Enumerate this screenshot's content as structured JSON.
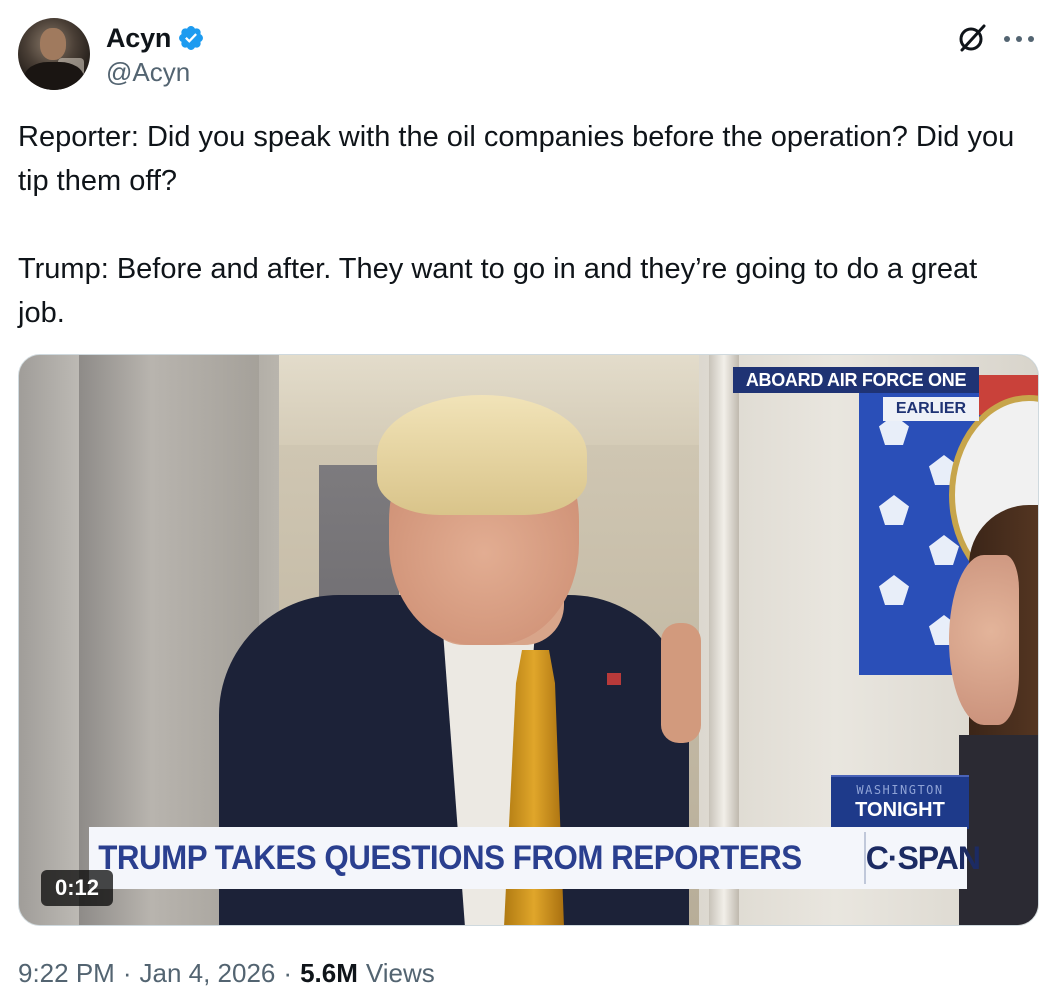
{
  "author": {
    "display_name": "Acyn",
    "handle": "@Acyn",
    "verified": true,
    "verified_color": "#1d9bf0"
  },
  "icons": {
    "grok": "grok-icon",
    "more": "more-options-icon"
  },
  "tweet": {
    "text": "Reporter: Did you speak with the oil companies before the operation? Did you tip them off?\n\nTrump: Before and after. They want to go in and they’re going to do a great job."
  },
  "media": {
    "type": "video",
    "duration": "0:12",
    "chyron": "TRUMP TAKES QUESTIONS FROM REPORTERS",
    "network": "C·SPAN",
    "location_label": "ABOARD AIR FORCE ONE",
    "location_sub": "EARLIER",
    "show_small": "WASHINGTON",
    "show_name": "TONIGHT"
  },
  "meta": {
    "time": "9:22 PM",
    "date": "Jan 4, 2026",
    "views_count": "5.6M",
    "views_label": "Views"
  }
}
